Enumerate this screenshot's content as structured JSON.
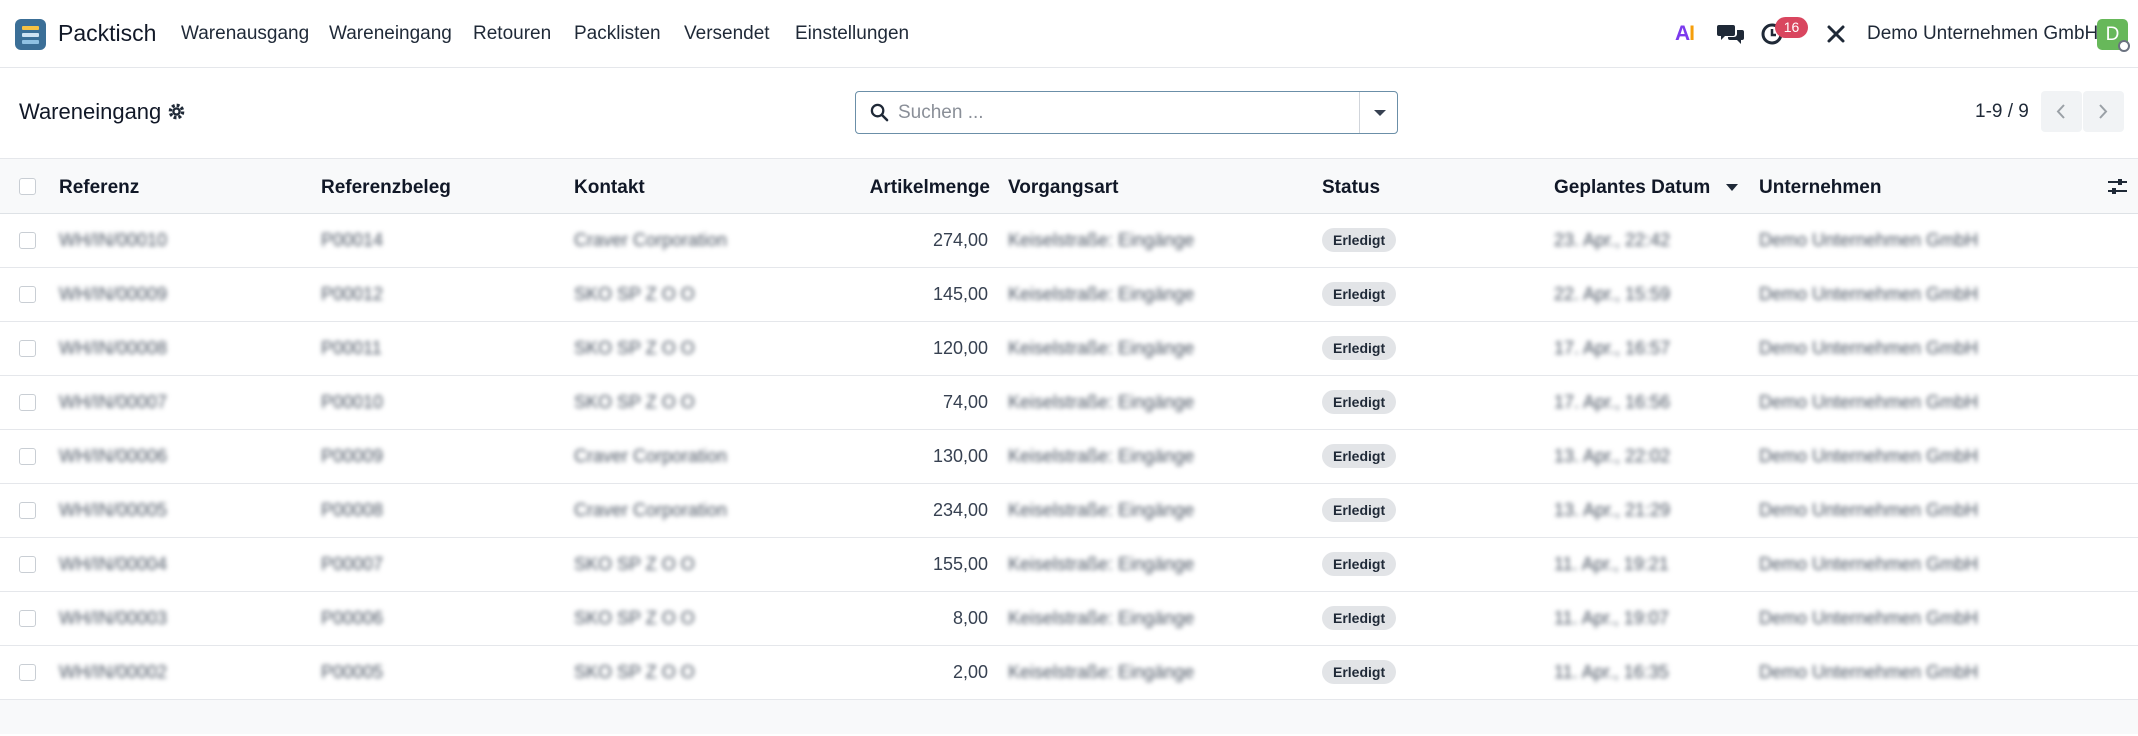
{
  "app": {
    "name": "Packtisch"
  },
  "nav": {
    "menu": [
      "Warenausgang",
      "Wareneingang",
      "Retouren",
      "Packlisten",
      "Versendet",
      "Einstellungen"
    ],
    "ai_label_a": "A",
    "ai_label_i": "I",
    "activity_count": "16",
    "company": "Demo Unternehmen GmbH",
    "avatar_initial": "D"
  },
  "control": {
    "title": "Wareneingang",
    "search_placeholder": "Suchen ...",
    "pager": "1-9 / 9"
  },
  "table": {
    "columns": {
      "reference": "Referenz",
      "source_document": "Referenzbeleg",
      "contact": "Kontakt",
      "quantity": "Artikelmenge",
      "operation_type": "Vorgangsart",
      "status": "Status",
      "scheduled_date": "Geplantes Datum",
      "company": "Unternehmen"
    },
    "rows": [
      {
        "reference": "WH/IN/00010",
        "source_document": "P00014",
        "contact": "Craver Corporation",
        "quantity": "274,00",
        "operation_type": "Keiselstraße: Eingänge",
        "status": "Erledigt",
        "scheduled_date": "23. Apr., 22:42",
        "company": "Demo Unternehmen GmbH"
      },
      {
        "reference": "WH/IN/00009",
        "source_document": "P00012",
        "contact": "SKO SP Z O O",
        "quantity": "145,00",
        "operation_type": "Keiselstraße: Eingänge",
        "status": "Erledigt",
        "scheduled_date": "22. Apr., 15:59",
        "company": "Demo Unternehmen GmbH"
      },
      {
        "reference": "WH/IN/00008",
        "source_document": "P00011",
        "contact": "SKO SP Z O O",
        "quantity": "120,00",
        "operation_type": "Keiselstraße: Eingänge",
        "status": "Erledigt",
        "scheduled_date": "17. Apr., 16:57",
        "company": "Demo Unternehmen GmbH"
      },
      {
        "reference": "WH/IN/00007",
        "source_document": "P00010",
        "contact": "SKO SP Z O O",
        "quantity": "74,00",
        "operation_type": "Keiselstraße: Eingänge",
        "status": "Erledigt",
        "scheduled_date": "17. Apr., 16:56",
        "company": "Demo Unternehmen GmbH"
      },
      {
        "reference": "WH/IN/00006",
        "source_document": "P00009",
        "contact": "Craver Corporation",
        "quantity": "130,00",
        "operation_type": "Keiselstraße: Eingänge",
        "status": "Erledigt",
        "scheduled_date": "13. Apr., 22:02",
        "company": "Demo Unternehmen GmbH"
      },
      {
        "reference": "WH/IN/00005",
        "source_document": "P00008",
        "contact": "Craver Corporation",
        "quantity": "234,00",
        "operation_type": "Keiselstraße: Eingänge",
        "status": "Erledigt",
        "scheduled_date": "13. Apr., 21:29",
        "company": "Demo Unternehmen GmbH"
      },
      {
        "reference": "WH/IN/00004",
        "source_document": "P00007",
        "contact": "SKO SP Z O O",
        "quantity": "155,00",
        "operation_type": "Keiselstraße: Eingänge",
        "status": "Erledigt",
        "scheduled_date": "11. Apr., 19:21",
        "company": "Demo Unternehmen GmbH"
      },
      {
        "reference": "WH/IN/00003",
        "source_document": "P00006",
        "contact": "SKO SP Z O O",
        "quantity": "8,00",
        "operation_type": "Keiselstraße: Eingänge",
        "status": "Erledigt",
        "scheduled_date": "11. Apr., 19:07",
        "company": "Demo Unternehmen GmbH"
      },
      {
        "reference": "WH/IN/00002",
        "source_document": "P00005",
        "contact": "SKO SP Z O O",
        "quantity": "2,00",
        "operation_type": "Keiselstraße: Eingänge",
        "status": "Erledigt",
        "scheduled_date": "11. Apr., 16:35",
        "company": "Demo Unternehmen GmbH"
      }
    ]
  },
  "icons": {
    "app": "app-icon",
    "ai": "ai-icon",
    "chat": "chat-icon",
    "activity": "clock-icon",
    "tools": "tools-icon",
    "settings": "gear-icon",
    "search": "search-icon",
    "optional_columns": "sliders-icon"
  },
  "colors": {
    "accent": "#3b6f97",
    "activity_badge": "#d9465f",
    "avatar": "#67b85a",
    "status_badge": "#e2e4e7"
  }
}
